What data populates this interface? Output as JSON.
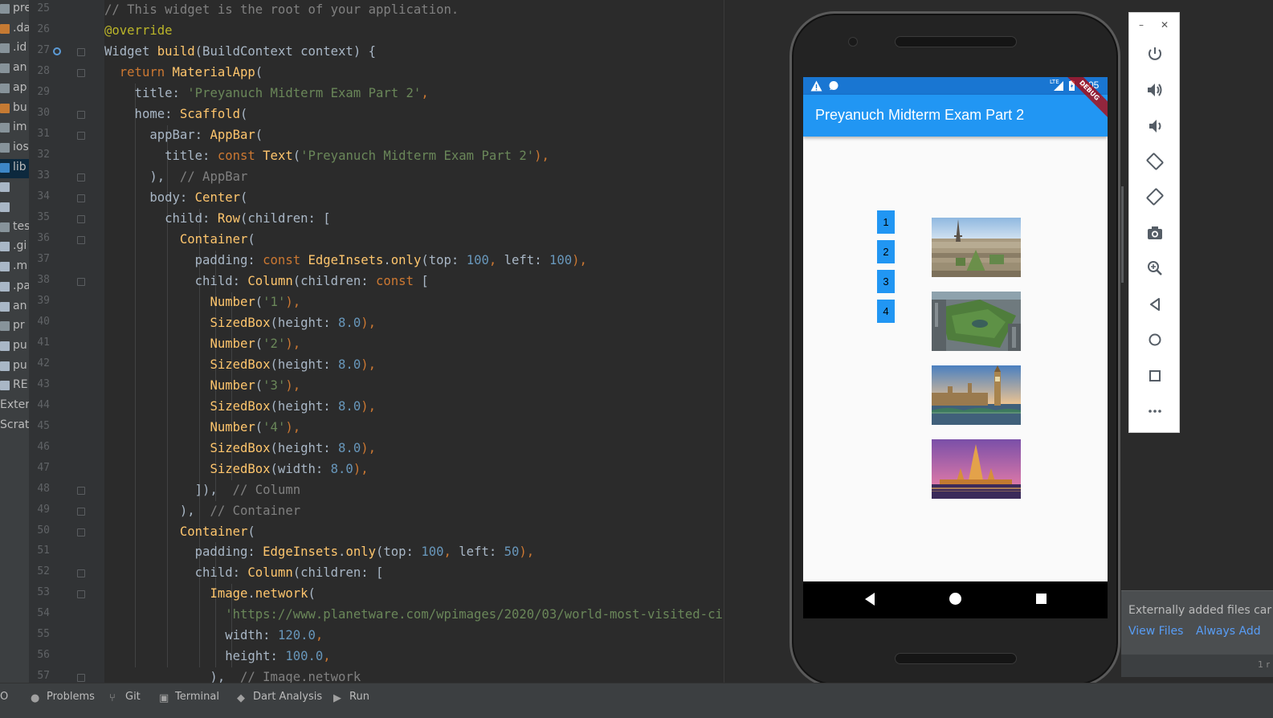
{
  "project_tree": [
    {
      "label": "preya",
      "icon": "folder-icon",
      "selected": false
    },
    {
      "label": ".da",
      "icon": "folder-icon",
      "selected": false
    },
    {
      "label": ".id",
      "icon": "folder-icon",
      "selected": false
    },
    {
      "label": "an",
      "icon": "folder-icon",
      "selected": false
    },
    {
      "label": "ap",
      "icon": "folder-icon",
      "selected": false
    },
    {
      "label": "bu",
      "icon": "folder-icon",
      "selected": false
    },
    {
      "label": "im",
      "icon": "folder-icon",
      "selected": false
    },
    {
      "label": "ios",
      "icon": "folder-icon",
      "selected": false
    },
    {
      "label": "lib",
      "icon": "folder-icon",
      "selected": true
    },
    {
      "label": "",
      "icon": "dart-file-icon",
      "selected": false
    },
    {
      "label": "",
      "icon": "dart-file-icon",
      "selected": false
    },
    {
      "label": "tes",
      "icon": "folder-icon",
      "selected": false
    },
    {
      "label": ".gi",
      "icon": "file-icon",
      "selected": false
    },
    {
      "label": ".m",
      "icon": "file-icon",
      "selected": false
    },
    {
      "label": ".pa",
      "icon": "file-icon",
      "selected": false
    },
    {
      "label": "an",
      "icon": "xml-file-icon",
      "selected": false
    },
    {
      "label": "pr",
      "icon": "folder-icon",
      "selected": false
    },
    {
      "label": "pu",
      "icon": "file-icon",
      "selected": false
    },
    {
      "label": "pu",
      "icon": "xml-file-icon",
      "selected": false
    },
    {
      "label": "RE",
      "icon": "file-icon",
      "selected": false
    },
    {
      "label": "Extern",
      "icon": "",
      "selected": false
    },
    {
      "label": "Scratc",
      "icon": "",
      "selected": false
    }
  ],
  "editor": {
    "line_numbers": [
      "25",
      "26",
      "27",
      "28",
      "29",
      "30",
      "31",
      "32",
      "33",
      "34",
      "35",
      "36",
      "37",
      "38",
      "39",
      "40",
      "41",
      "42",
      "43",
      "44",
      "45",
      "46",
      "47",
      "48",
      "49",
      "50",
      "51",
      "52",
      "53",
      "54",
      "55",
      "56",
      "57"
    ],
    "lines": [
      [
        {
          "t": "// This widget is the root of your application.",
          "c": "c"
        }
      ],
      [
        {
          "t": "@override",
          "c": "an"
        }
      ],
      [
        {
          "t": "Widget ",
          "c": ""
        },
        {
          "t": "build",
          "c": "fn"
        },
        {
          "t": "(BuildContext context) {",
          "c": ""
        }
      ],
      [
        {
          "t": "  return ",
          "c": "k"
        },
        {
          "t": "MaterialApp",
          "c": "fn"
        },
        {
          "t": "(",
          "c": ""
        }
      ],
      [
        {
          "t": "    title: ",
          "c": ""
        },
        {
          "t": "'Preyanuch Midterm Exam Part 2'",
          "c": "s"
        },
        {
          "t": ",",
          "c": "p"
        }
      ],
      [
        {
          "t": "    home: ",
          "c": ""
        },
        {
          "t": "Scaffold",
          "c": "fn"
        },
        {
          "t": "(",
          "c": ""
        }
      ],
      [
        {
          "t": "      appBar: ",
          "c": ""
        },
        {
          "t": "AppBar",
          "c": "fn"
        },
        {
          "t": "(",
          "c": ""
        }
      ],
      [
        {
          "t": "        title: ",
          "c": ""
        },
        {
          "t": "const ",
          "c": "k"
        },
        {
          "t": "Text",
          "c": "fn"
        },
        {
          "t": "(",
          "c": ""
        },
        {
          "t": "'Preyanuch Midterm Exam Part 2'",
          "c": "s"
        },
        {
          "t": "),",
          "c": "p"
        }
      ],
      [
        {
          "t": "      ),  ",
          "c": ""
        },
        {
          "t": "// AppBar",
          "c": "c"
        }
      ],
      [
        {
          "t": "      body: ",
          "c": ""
        },
        {
          "t": "Center",
          "c": "fn"
        },
        {
          "t": "(",
          "c": ""
        }
      ],
      [
        {
          "t": "        child: ",
          "c": ""
        },
        {
          "t": "Row",
          "c": "fn"
        },
        {
          "t": "(children: [",
          "c": ""
        }
      ],
      [
        {
          "t": "          ",
          "c": ""
        },
        {
          "t": "Container",
          "c": "fn"
        },
        {
          "t": "(",
          "c": ""
        }
      ],
      [
        {
          "t": "            padding: ",
          "c": ""
        },
        {
          "t": "const ",
          "c": "k"
        },
        {
          "t": "EdgeInsets",
          "c": "fn"
        },
        {
          "t": ".",
          "c": ""
        },
        {
          "t": "only",
          "c": "fn"
        },
        {
          "t": "(top: ",
          "c": ""
        },
        {
          "t": "100",
          "c": "n"
        },
        {
          "t": ", ",
          "c": "p"
        },
        {
          "t": "left: ",
          "c": ""
        },
        {
          "t": "100",
          "c": "n"
        },
        {
          "t": "),",
          "c": "p"
        }
      ],
      [
        {
          "t": "            child: ",
          "c": ""
        },
        {
          "t": "Column",
          "c": "fn"
        },
        {
          "t": "(children: ",
          "c": ""
        },
        {
          "t": "const ",
          "c": "k"
        },
        {
          "t": "[",
          "c": ""
        }
      ],
      [
        {
          "t": "              ",
          "c": ""
        },
        {
          "t": "Number",
          "c": "fn"
        },
        {
          "t": "(",
          "c": ""
        },
        {
          "t": "'1'",
          "c": "s"
        },
        {
          "t": "),",
          "c": "p"
        }
      ],
      [
        {
          "t": "              ",
          "c": ""
        },
        {
          "t": "SizedBox",
          "c": "fn"
        },
        {
          "t": "(height: ",
          "c": ""
        },
        {
          "t": "8.0",
          "c": "n"
        },
        {
          "t": "),",
          "c": "p"
        }
      ],
      [
        {
          "t": "              ",
          "c": ""
        },
        {
          "t": "Number",
          "c": "fn"
        },
        {
          "t": "(",
          "c": ""
        },
        {
          "t": "'2'",
          "c": "s"
        },
        {
          "t": "),",
          "c": "p"
        }
      ],
      [
        {
          "t": "              ",
          "c": ""
        },
        {
          "t": "SizedBox",
          "c": "fn"
        },
        {
          "t": "(height: ",
          "c": ""
        },
        {
          "t": "8.0",
          "c": "n"
        },
        {
          "t": "),",
          "c": "p"
        }
      ],
      [
        {
          "t": "              ",
          "c": ""
        },
        {
          "t": "Number",
          "c": "fn"
        },
        {
          "t": "(",
          "c": ""
        },
        {
          "t": "'3'",
          "c": "s"
        },
        {
          "t": "),",
          "c": "p"
        }
      ],
      [
        {
          "t": "              ",
          "c": ""
        },
        {
          "t": "SizedBox",
          "c": "fn"
        },
        {
          "t": "(height: ",
          "c": ""
        },
        {
          "t": "8.0",
          "c": "n"
        },
        {
          "t": "),",
          "c": "p"
        }
      ],
      [
        {
          "t": "              ",
          "c": ""
        },
        {
          "t": "Number",
          "c": "fn"
        },
        {
          "t": "(",
          "c": ""
        },
        {
          "t": "'4'",
          "c": "s"
        },
        {
          "t": "),",
          "c": "p"
        }
      ],
      [
        {
          "t": "              ",
          "c": ""
        },
        {
          "t": "SizedBox",
          "c": "fn"
        },
        {
          "t": "(height: ",
          "c": ""
        },
        {
          "t": "8.0",
          "c": "n"
        },
        {
          "t": "),",
          "c": "p"
        }
      ],
      [
        {
          "t": "              ",
          "c": ""
        },
        {
          "t": "SizedBox",
          "c": "fn"
        },
        {
          "t": "(width: ",
          "c": ""
        },
        {
          "t": "8.0",
          "c": "n"
        },
        {
          "t": "),",
          "c": "p"
        }
      ],
      [
        {
          "t": "            ]),  ",
          "c": ""
        },
        {
          "t": "// Column",
          "c": "c"
        }
      ],
      [
        {
          "t": "          ),  ",
          "c": ""
        },
        {
          "t": "// Container",
          "c": "c"
        }
      ],
      [
        {
          "t": "          ",
          "c": ""
        },
        {
          "t": "Container",
          "c": "fn"
        },
        {
          "t": "(",
          "c": ""
        }
      ],
      [
        {
          "t": "            padding: ",
          "c": ""
        },
        {
          "t": "EdgeInsets",
          "c": "fn"
        },
        {
          "t": ".",
          "c": ""
        },
        {
          "t": "only",
          "c": "fn"
        },
        {
          "t": "(top: ",
          "c": ""
        },
        {
          "t": "100",
          "c": "n"
        },
        {
          "t": ", ",
          "c": "p"
        },
        {
          "t": "left: ",
          "c": ""
        },
        {
          "t": "50",
          "c": "n"
        },
        {
          "t": "),",
          "c": "p"
        }
      ],
      [
        {
          "t": "            child: ",
          "c": ""
        },
        {
          "t": "Column",
          "c": "fn"
        },
        {
          "t": "(children: [",
          "c": ""
        }
      ],
      [
        {
          "t": "              ",
          "c": ""
        },
        {
          "t": "Image",
          "c": "fn"
        },
        {
          "t": ".",
          "c": ""
        },
        {
          "t": "network",
          "c": "fn"
        },
        {
          "t": "(",
          "c": ""
        }
      ],
      [
        {
          "t": "                ",
          "c": ""
        },
        {
          "t": "'https://www.planetware.com/wpimages/2020/03/world-most-visited-ci",
          "c": "s"
        }
      ],
      [
        {
          "t": "                width: ",
          "c": ""
        },
        {
          "t": "120.0",
          "c": "n"
        },
        {
          "t": ",",
          "c": "p"
        }
      ],
      [
        {
          "t": "                height: ",
          "c": ""
        },
        {
          "t": "100.0",
          "c": "n"
        },
        {
          "t": ",",
          "c": "p"
        }
      ],
      [
        {
          "t": "              ),  ",
          "c": ""
        },
        {
          "t": "// Image.network",
          "c": "c"
        }
      ]
    ]
  },
  "status_bar": {
    "items": [
      {
        "label": "Problems",
        "icon": "problems-icon"
      },
      {
        "label": "Git",
        "icon": "git-icon"
      },
      {
        "label": "Terminal",
        "icon": "terminal-icon"
      },
      {
        "label": "Dart Analysis",
        "icon": "dart-analysis-icon"
      },
      {
        "label": "Run",
        "icon": "run-icon"
      }
    ],
    "left_fragment": "O"
  },
  "phone": {
    "status_time": "4:05",
    "status_network": "LTE",
    "debug_label": "DEBUG",
    "app_title": "Preyanuch Midterm Exam Part 2",
    "numbers": [
      "1",
      "2",
      "3",
      "4"
    ],
    "images": [
      "paris-image",
      "central-park-image",
      "london-image",
      "bangkok-temple-image"
    ]
  },
  "emulator_toolbar": {
    "buttons": [
      "power-icon",
      "volume-up-icon",
      "volume-down-icon",
      "rotate-left-icon",
      "rotate-right-icon",
      "camera-icon",
      "zoom-icon",
      "back-icon",
      "home-icon",
      "overview-icon",
      "more-icon"
    ],
    "minimize": "–",
    "close": "✕"
  },
  "notification": {
    "text": "Externally added files car",
    "view_files": "View Files",
    "always_add": "Always Add",
    "time": "1 r"
  },
  "colors": {
    "app_bar": "#2196f3",
    "status_bar_android": "#1976d2",
    "editor_bg": "#2b2b2b"
  }
}
